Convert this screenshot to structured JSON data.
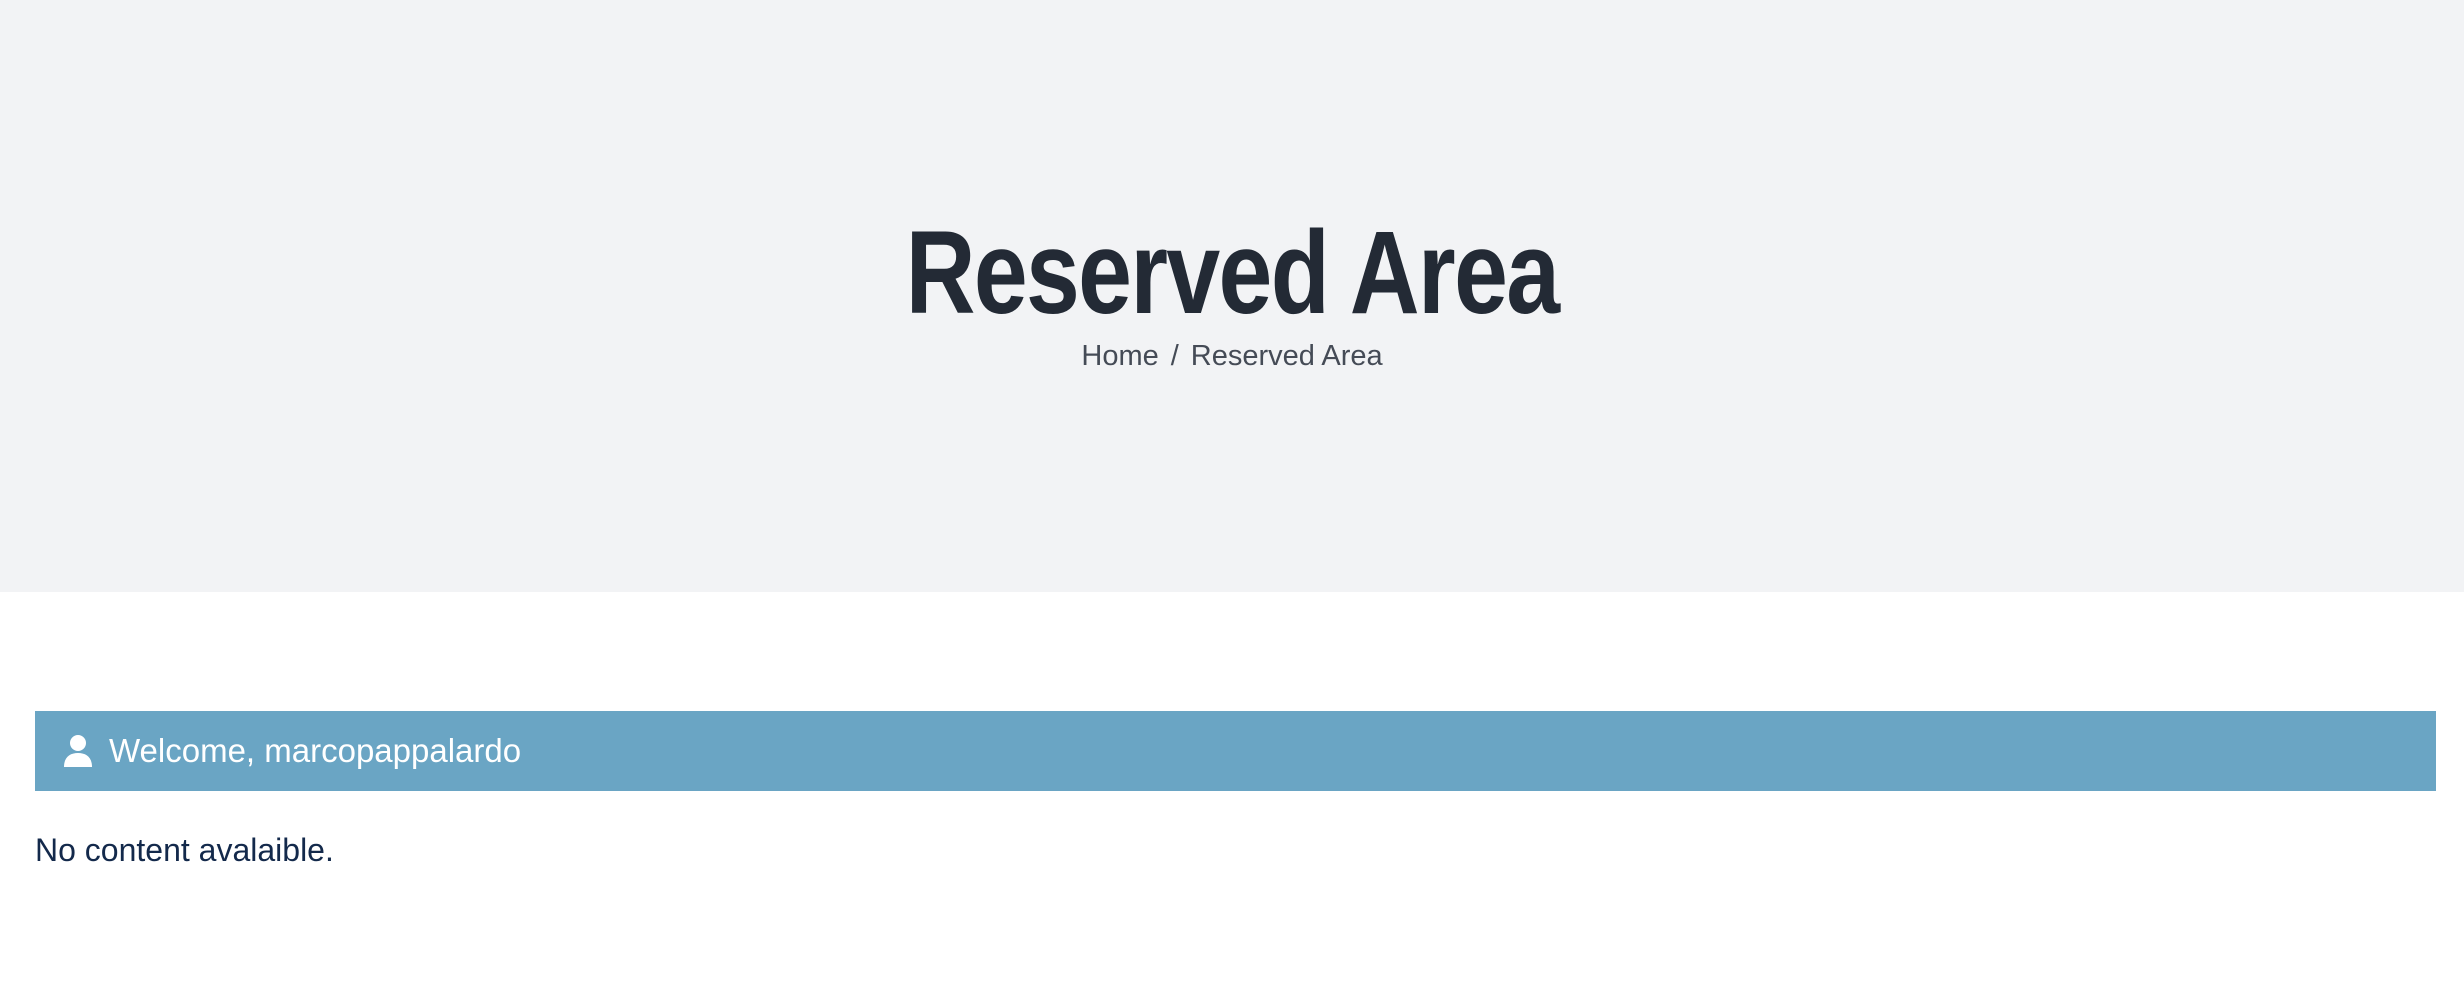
{
  "hero": {
    "title": "Reserved Area",
    "breadcrumb": {
      "home": "Home",
      "separator": "/",
      "current": "Reserved Area"
    }
  },
  "welcome": {
    "icon": "user-icon",
    "text": "Welcome, marcopappalardo"
  },
  "content": {
    "message": "No content avalaible."
  },
  "colors": {
    "hero_background": "#f2f3f5",
    "title": "#232a35",
    "welcome_bar": "#6aa5c4",
    "message": "#13294b"
  }
}
